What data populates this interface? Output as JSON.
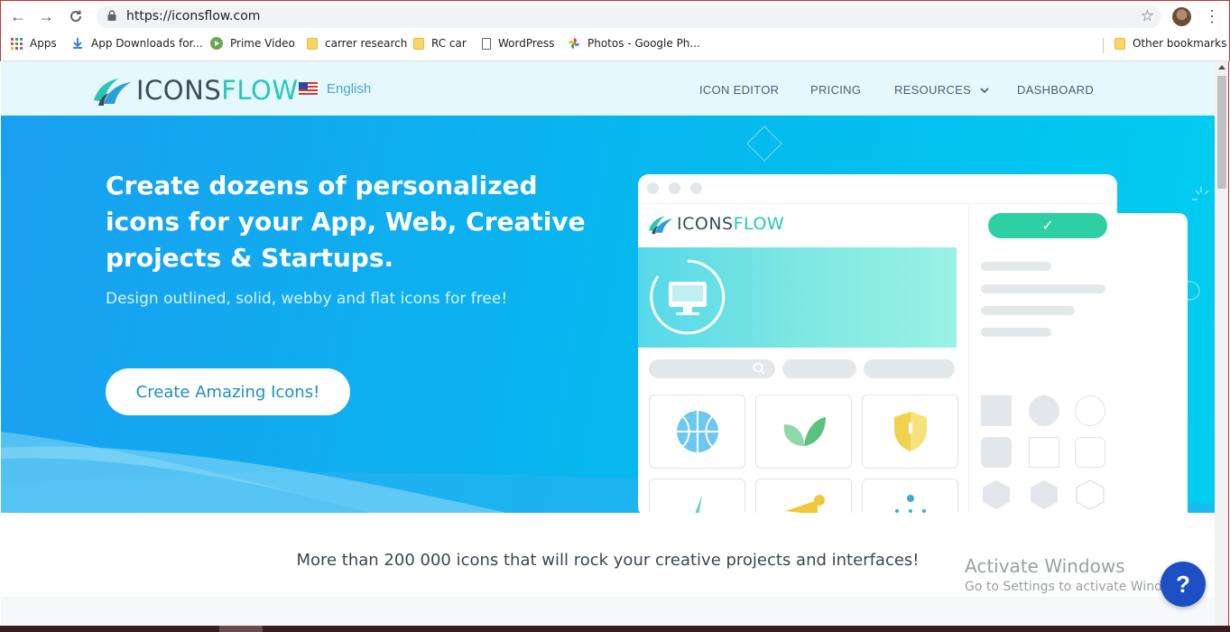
{
  "browser": {
    "url": "https://iconsflow.com",
    "bookmarks": [
      {
        "label": "Apps",
        "icon": "apps-grid-icon"
      },
      {
        "label": "App Downloads for...",
        "icon": "download-icon"
      },
      {
        "label": "Prime Video",
        "icon": "play-icon"
      },
      {
        "label": "carrer research",
        "icon": "folder-icon"
      },
      {
        "label": "RC car",
        "icon": "folder-icon"
      },
      {
        "label": "WordPress",
        "icon": "page-icon"
      },
      {
        "label": "Photos - Google Ph...",
        "icon": "pinwheel-icon"
      }
    ],
    "other_bookmarks": "Other bookmarks"
  },
  "site": {
    "logo": {
      "part1": "ICONS",
      "part2": "FLOW"
    },
    "language": "English",
    "nav": [
      "ICON EDITOR",
      "PRICING",
      "RESOURCES",
      "DASHBOARD"
    ]
  },
  "hero": {
    "title": "Create dozens of personalized icons for your App, Web, Creative projects & Startups.",
    "subtitle": "Design outlined, solid, webby and flat icons for free!",
    "cta": "Create Amazing Icons!",
    "mockup_logo": {
      "part1": "ICONS",
      "part2": "FLOW"
    }
  },
  "tagline": "More than 200 000 icons that will rock your creative projects and interfaces!",
  "overlay": {
    "activate_title": "Activate Windows",
    "activate_sub": "Go to Settings to activate Windows.",
    "help": "?"
  },
  "colors": {
    "brand_dark": "#3d4b5b",
    "brand_teal": "#27c8b7",
    "hero_blue": "#06b9ee",
    "cta_text": "#1d8fc8",
    "help_button": "#1d4fc4"
  }
}
